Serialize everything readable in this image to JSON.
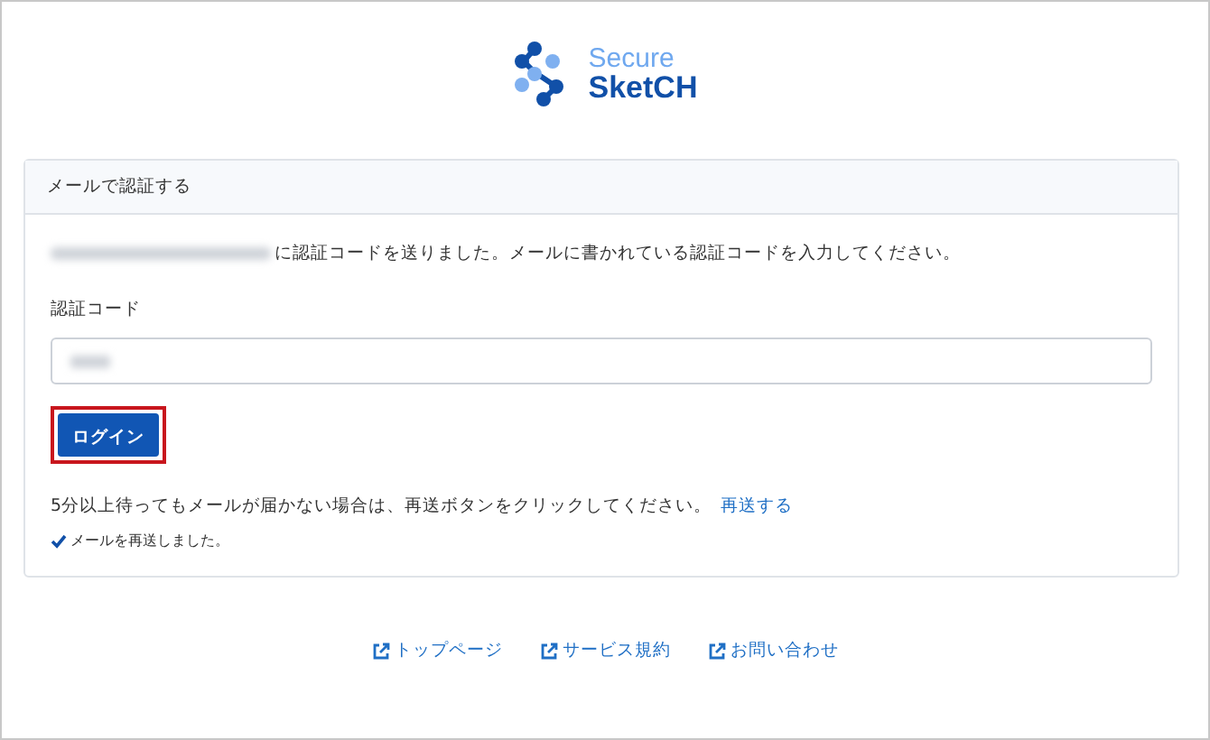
{
  "logo": {
    "line_1": "Secure",
    "line_2": "SketCH"
  },
  "card": {
    "title": "メールで認証する",
    "message": "に認証コードを送りました。メールに書かれている認証コードを入力してください。",
    "code_label": "認証コード",
    "login_button": {
      "label": "ログイン",
      "highlighted": true
    },
    "resend_note": "5分以上待ってもメールが届かない場合は、再送ボタンをクリックしてください。",
    "resend_link": "再送する",
    "resend_status": {
      "text": "メールを再送しました。",
      "done": true
    }
  },
  "footer_links": [
    {
      "label": "トップページ"
    },
    {
      "label": "サービス規約"
    },
    {
      "label": "お問い合わせ"
    }
  ]
}
